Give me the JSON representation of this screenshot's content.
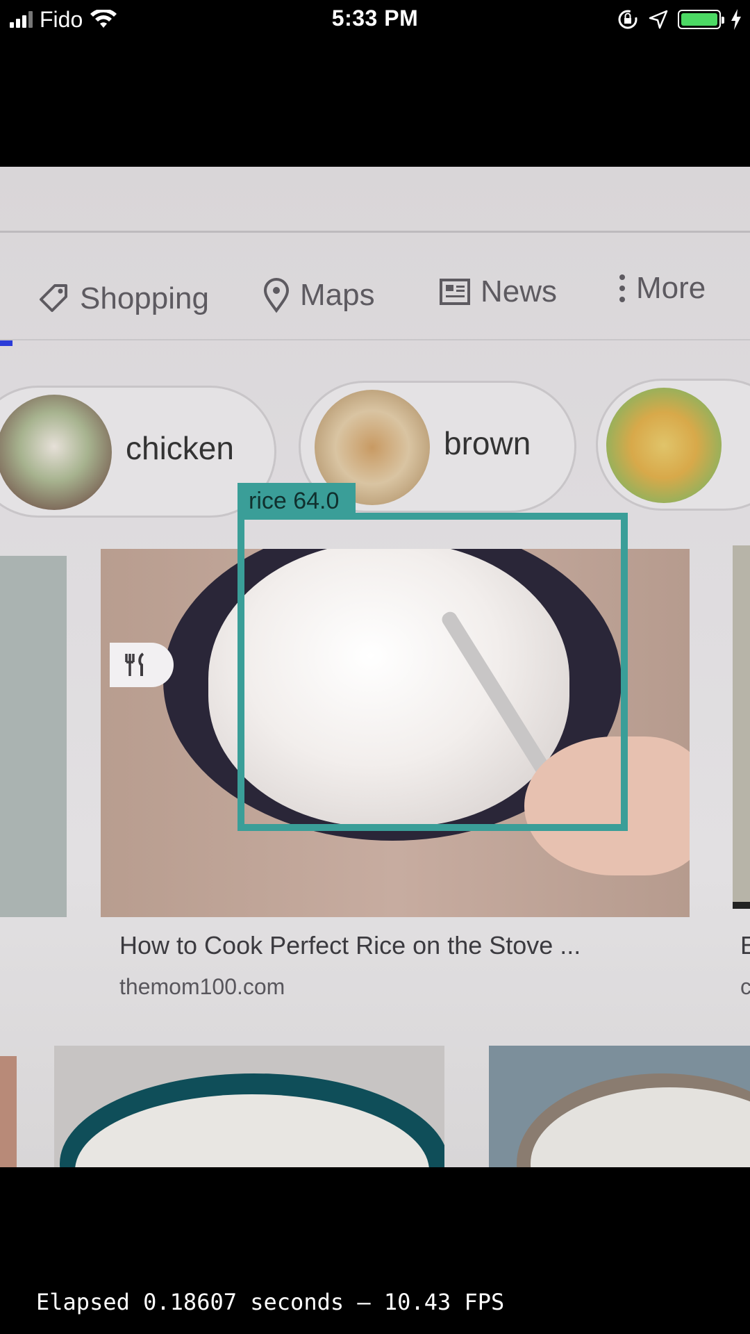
{
  "status_bar": {
    "carrier": "Fido",
    "time": "5:33 PM",
    "battery_level": 1.0,
    "icons": [
      "signal-icon",
      "wifi-icon",
      "orientation-lock-icon",
      "location-arrow-icon",
      "battery-icon",
      "charging-bolt-icon"
    ]
  },
  "camera_view": {
    "nav_tabs": [
      {
        "label": "Shopping",
        "icon": "tag-icon"
      },
      {
        "label": "Maps",
        "icon": "map-pin-icon"
      },
      {
        "label": "News",
        "icon": "news-icon"
      },
      {
        "label": "More",
        "icon": "more-vertical-icon"
      }
    ],
    "chips": [
      {
        "label": "chicken"
      },
      {
        "label": "brown"
      },
      {
        "label": ""
      }
    ],
    "detection": {
      "label": "rice 64.0",
      "color": "#3a9e98"
    },
    "result": {
      "title": "How to Cook Perfect Rice on the Stove ...",
      "site": "themom100.com",
      "badge_icon": "fork-knife-icon",
      "title_right": "E",
      "site_right": "c"
    }
  },
  "footer": {
    "elapsed": "Elapsed 0.18607 seconds – 10.43 FPS"
  }
}
